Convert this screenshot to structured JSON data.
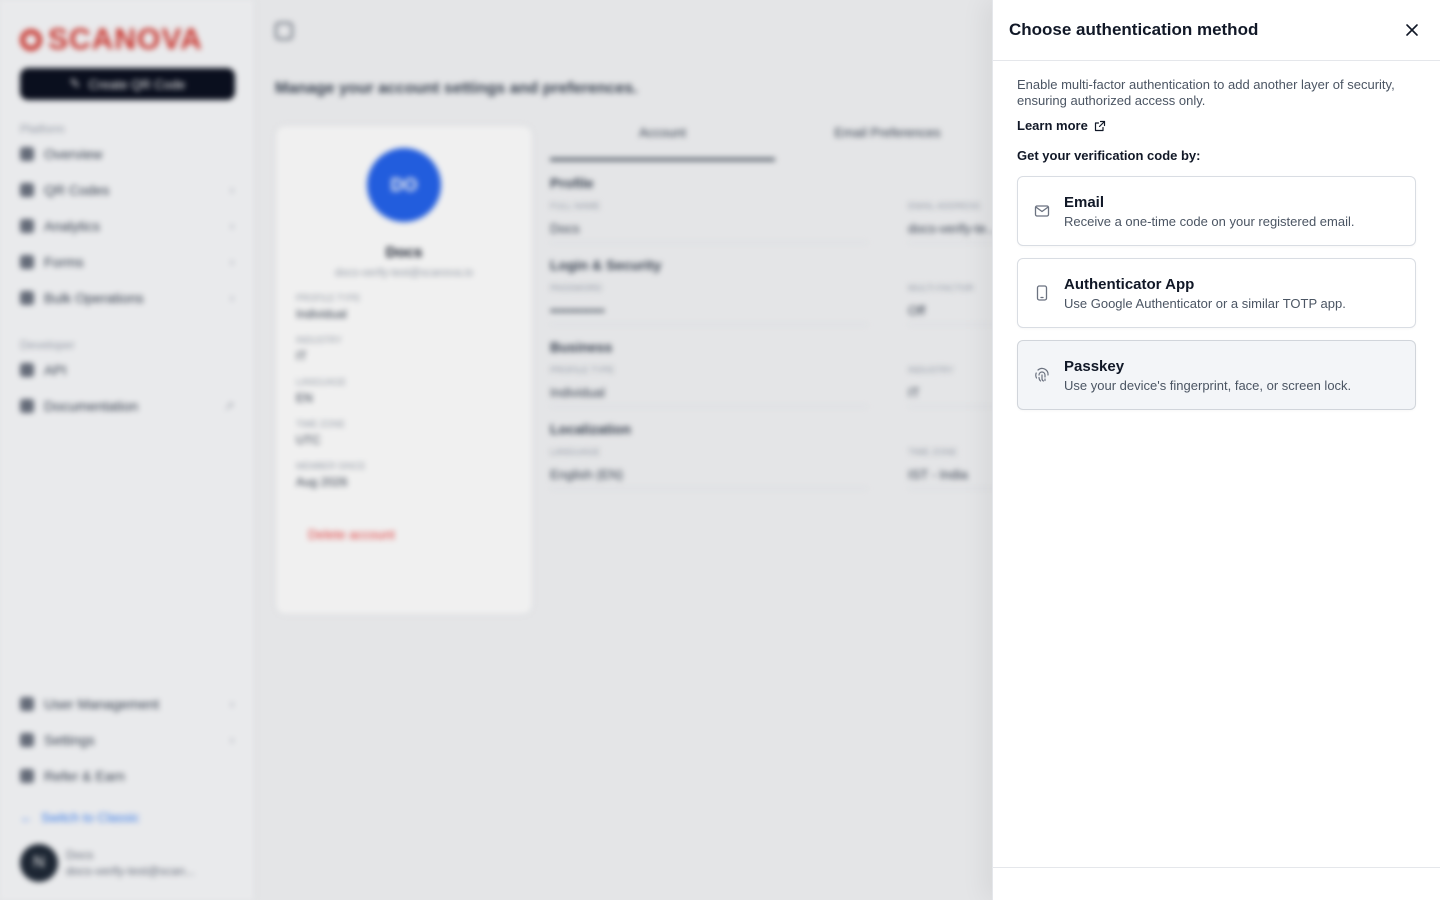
{
  "background": {
    "sidebar": {
      "logo": "SCANOVA",
      "create_button": "Create QR Code",
      "platform_label": "Platform",
      "platform_items": [
        "Overview",
        "QR Codes",
        "Analytics",
        "Forms",
        "Bulk Operations"
      ],
      "developer_label": "Developer",
      "developer_items": [
        "API",
        "Documentation"
      ],
      "bottom_items": [
        "User Management",
        "Settings"
      ],
      "refer": "Refer & Earn",
      "switch": "Switch to Classic",
      "user_initial": "N",
      "user_name": "Docs",
      "user_email": "docs-verify-test@scan..."
    },
    "main": {
      "subtitle": "Manage your account settings and preferences.",
      "profile": {
        "initials": "DO",
        "name": "Docs",
        "email": "docs-verify-test@scanova.io",
        "fields": [
          {
            "k": "PROFILE TYPE",
            "v": "Individual"
          },
          {
            "k": "INDUSTRY",
            "v": "IT"
          },
          {
            "k": "LANGUAGE",
            "v": "EN"
          },
          {
            "k": "TIME ZONE",
            "v": "UTC"
          },
          {
            "k": "MEMBER SINCE",
            "v": "Aug 2026"
          }
        ],
        "delete": "Delete account"
      },
      "tabs": [
        "Account",
        "Email Preferences"
      ],
      "sections": [
        {
          "title": "Profile",
          "fields": [
            {
              "k": "FULL NAME",
              "v": "Docs"
            },
            {
              "k": "EMAIL ADDRESS",
              "v": "docs-verify-te..."
            }
          ]
        },
        {
          "title": "Login & Security",
          "fields": [
            {
              "k": "PASSWORD",
              "v": "••••••••••••"
            },
            {
              "k": "MULTI-FACTOR",
              "v": "Off"
            }
          ]
        },
        {
          "title": "Business",
          "fields": [
            {
              "k": "PROFILE TYPE",
              "v": "Individual"
            },
            {
              "k": "INDUSTRY",
              "v": "IT"
            }
          ]
        },
        {
          "title": "Localization",
          "fields": [
            {
              "k": "LANGUAGE",
              "v": "English (EN)"
            },
            {
              "k": "TIME ZONE",
              "v": "IST - India"
            }
          ]
        }
      ]
    }
  },
  "drawer": {
    "title": "Choose authentication method",
    "intro": "Enable multi-factor authentication to add another layer of security, ensuring authorized access only.",
    "learn_more": "Learn more",
    "get_code_label": "Get your verification code by:",
    "methods": [
      {
        "title": "Email",
        "desc": "Receive a one-time code on your registered email.",
        "icon": "mail-icon"
      },
      {
        "title": "Authenticator App",
        "desc": "Use Google Authenticator or a similar TOTP app.",
        "icon": "smartphone-icon"
      },
      {
        "title": "Passkey",
        "desc": "Use your device's fingerprint, face, or screen lock.",
        "icon": "fingerprint-icon"
      }
    ]
  }
}
